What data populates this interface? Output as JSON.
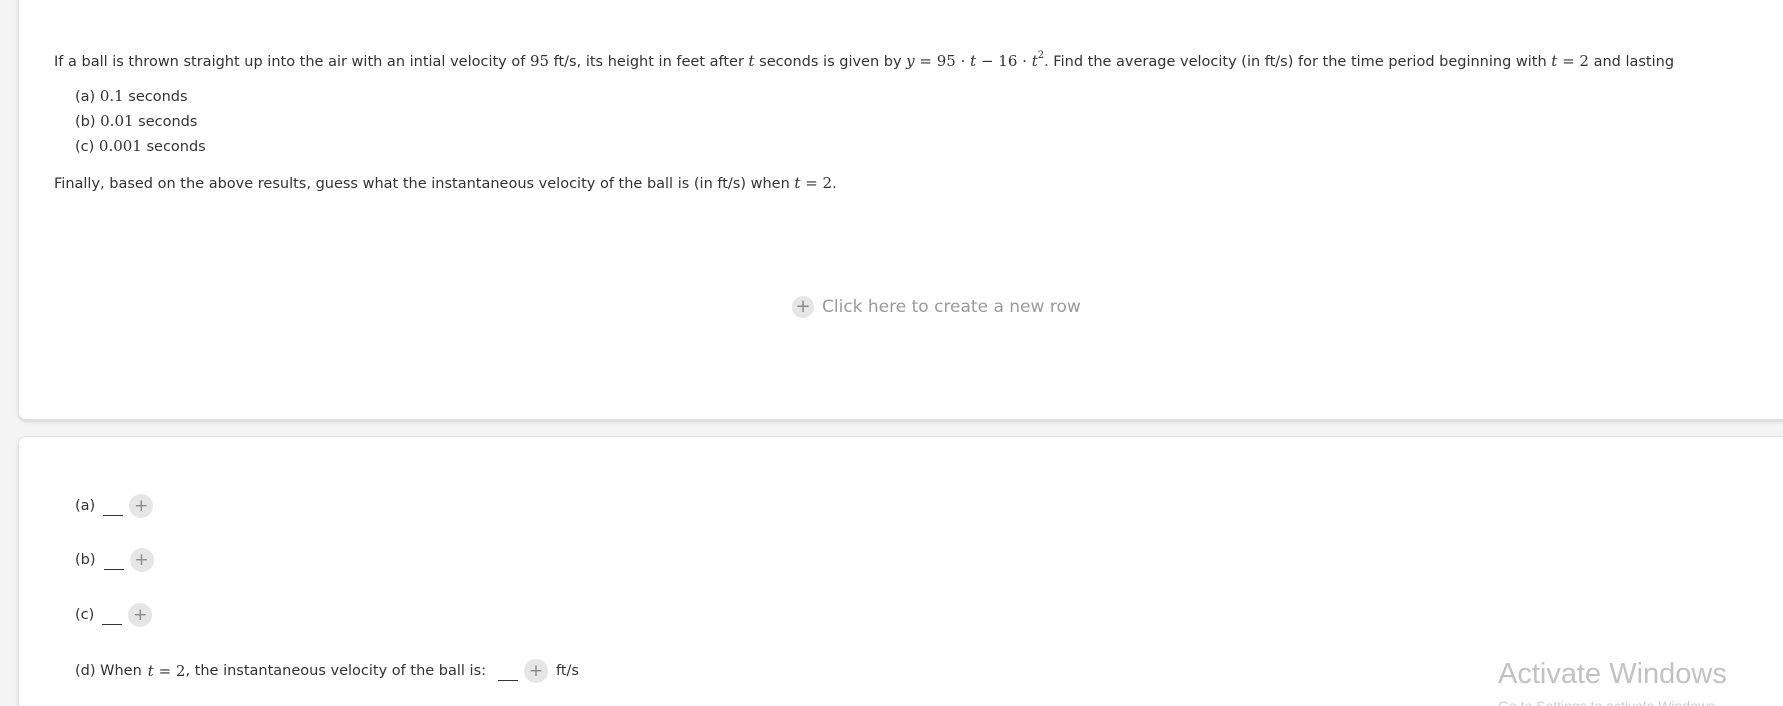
{
  "question": {
    "intro": "If a ball is thrown straight up into the air with an intial velocity of ",
    "velocity_value": "95",
    "after_velocity": " ft/s, its height in feet after ",
    "var_t": "t",
    "after_t": " seconds is given by ",
    "formula": {
      "y": "y",
      "eq": " = 95 · ",
      "t1": "t",
      "minus": " − 16 · ",
      "t2": "t",
      "exp": "2"
    },
    "after_formula": ". Find the average velocity (in ft/s) for the time period beginning with ",
    "start_t": "t",
    "start_eq": " = 2",
    "ending": " and lasting"
  },
  "parts": [
    {
      "label": "(a) ",
      "value": "0.1",
      "unit": " seconds"
    },
    {
      "label": "(b) ",
      "value": "0.01",
      "unit": " seconds"
    },
    {
      "label": "(c) ",
      "value": "0.001",
      "unit": " seconds"
    }
  ],
  "final": {
    "text": "Finally, based on the above results, guess what the instantaneous velocity of the ball is (in ft/s) when ",
    "t": "t",
    "eq": " = 2",
    "end": "."
  },
  "new_row": {
    "icon": "plus-icon",
    "label": "Click here to create a new row"
  },
  "answers": [
    {
      "label": "(a)"
    },
    {
      "label": "(b)"
    },
    {
      "label": "(c)"
    }
  ],
  "answer_d": {
    "prefix": "(d) When ",
    "t": "t",
    "eq": " = 2",
    "middle": " , the instantaneous velocity of the ball is:",
    "unit": "ft/s"
  },
  "watermark": {
    "title": "Activate Windows",
    "subtitle": "Go to Settings to activate Windows."
  },
  "colors": {
    "background": "#f4f4f4",
    "card": "#ffffff",
    "muted": "#9a9a9a",
    "plus_bg": "#e6e6e6"
  }
}
